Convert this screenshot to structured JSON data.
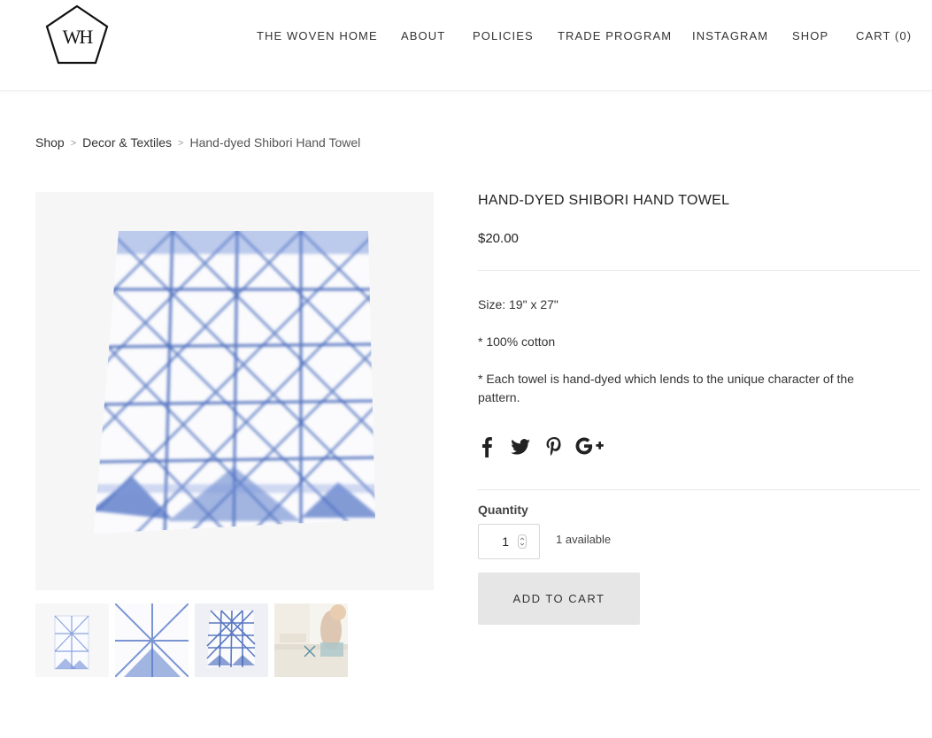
{
  "brand": {
    "logo_text": "WH"
  },
  "nav": {
    "items": [
      {
        "label": "THE WOVEN HOME"
      },
      {
        "label": "ABOUT"
      },
      {
        "label": "POLICIES"
      },
      {
        "label": "TRADE PROGRAM"
      },
      {
        "label": "INSTAGRAM"
      },
      {
        "label": "SHOP"
      },
      {
        "label": "CART (0)"
      }
    ]
  },
  "breadcrumb": {
    "items": [
      "Shop",
      "Decor & Textiles",
      "Hand-dyed Shibori Hand Towel"
    ],
    "separator": ">"
  },
  "product": {
    "title": "HAND-DYED SHIBORI HAND TOWEL",
    "price": "$20.00",
    "description": [
      "Size: 19\" x 27\"",
      "* 100% cotton",
      "* Each towel is hand-dyed which lends to the unique character of the pattern."
    ],
    "accent_color": "#3f63b8"
  },
  "social": {
    "icons": [
      "facebook-icon",
      "twitter-icon",
      "pinterest-icon",
      "google-plus-icon"
    ]
  },
  "purchase": {
    "quantity_label": "Quantity",
    "quantity_value": "1",
    "availability": "1 available",
    "add_to_cart_label": "ADD TO CART"
  }
}
